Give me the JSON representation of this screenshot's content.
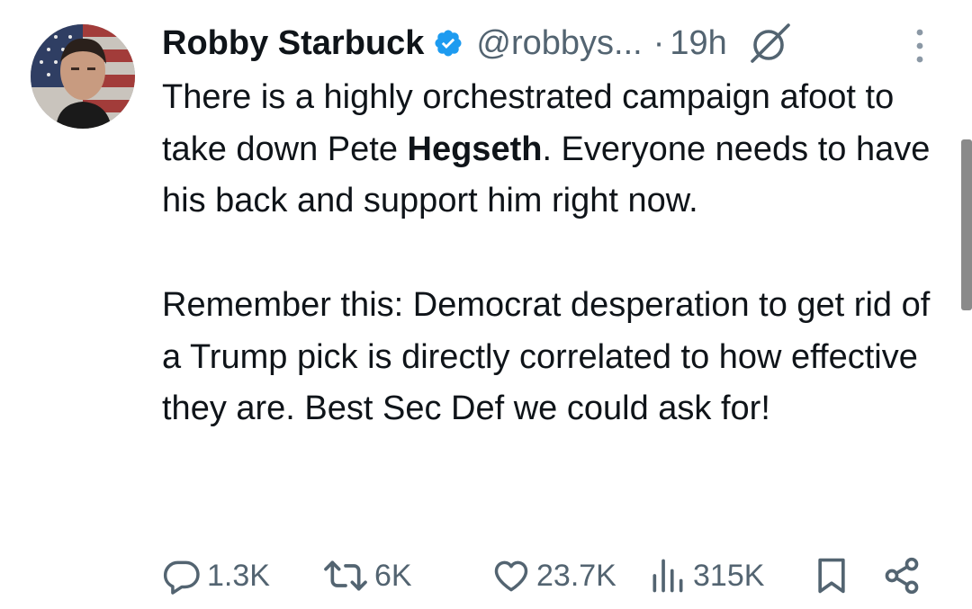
{
  "author": {
    "name": "Robby Starbuck",
    "handle": "@robbys...",
    "separator": "·",
    "time": "19h"
  },
  "tweet": {
    "p1_before": "There is a highly orchestrated campaign afoot to take down Pete ",
    "p1_bold": "Hegseth",
    "p1_after": ". Everyone needs to have his back and support him right now.",
    "p2": "Remember this: Democrat desperation to get rid of a Trump pick is directly correlated to how effective they are. Best Sec Def we could ask for!"
  },
  "actions": {
    "replies": "1.3K",
    "reposts": "6K",
    "likes": "23.7K",
    "views": "315K"
  },
  "icons": {
    "verified": "verified-badge-icon",
    "grok": "grok-icon",
    "more": "more-options-icon",
    "reply": "reply-icon",
    "repost": "repost-icon",
    "like": "heart-icon",
    "views": "views-chart-icon",
    "bookmark": "bookmark-icon",
    "share": "share-icon"
  },
  "colors": {
    "text": "#0f1419",
    "muted": "#536471",
    "verified_blue": "#1d9bf0"
  }
}
